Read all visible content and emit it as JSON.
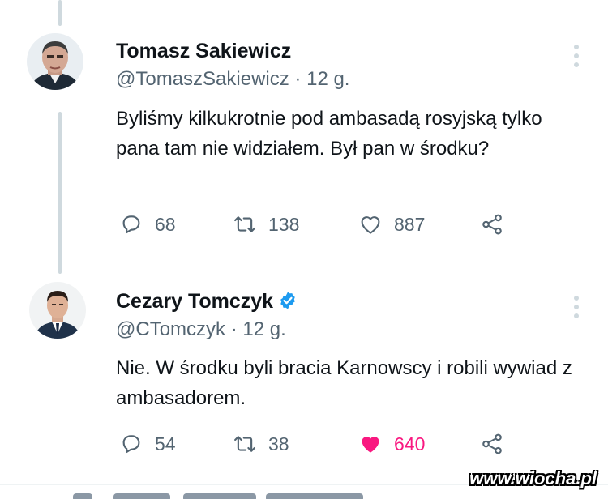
{
  "tweets": [
    {
      "author": "Tomasz Sakiewicz",
      "handle": "@TomaszSakiewicz",
      "separator": "·",
      "time": "12 g.",
      "text": "Byliśmy kilkukrotnie pod ambasadą rosyjską tylko pana tam nie widziałem. Był pan w środku?",
      "replies": "68",
      "retweets": "138",
      "likes": "887",
      "liked": false,
      "verified": false
    },
    {
      "author": "Cezary Tomczyk",
      "handle": "@CTomczyk",
      "separator": "·",
      "time": "12 g.",
      "text": "Nie. W środku byli bracia Karnowscy i robili wywiad z ambasadorem.",
      "replies": "54",
      "retweets": "38",
      "likes": "640",
      "liked": true,
      "verified": true
    }
  ],
  "watermark": "www.wiocha.pl",
  "colors": {
    "text": "#0f1419",
    "secondary": "#536471",
    "like_active": "#f91880",
    "verified": "#1d9bf0",
    "thread_line": "#cfd9de"
  }
}
